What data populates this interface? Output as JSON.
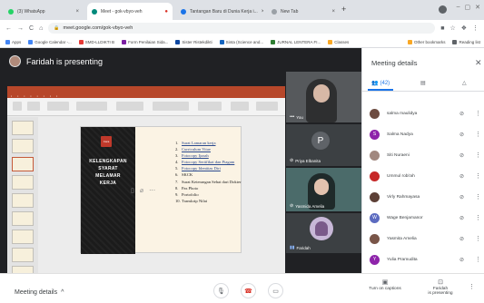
{
  "browser": {
    "tabs": [
      {
        "label": "(3) WhatsApp",
        "color": "#25d366",
        "active": false
      },
      {
        "label": "Meet - gok-vbyo-veh",
        "color": "#00897b",
        "active": true
      },
      {
        "label": "Tantangan Baru di Dunia Kerja i...",
        "color": "#1a73e8",
        "active": false
      },
      {
        "label": "New Tab",
        "color": "#9aa0a6",
        "active": false
      }
    ],
    "url": "meet.google.com/gok-vbyo-veh",
    "bookmarks": [
      {
        "label": "Apps",
        "color": "#4285f4"
      },
      {
        "label": "Google Calendar -...",
        "color": "#4285f4"
      },
      {
        "label": "SMD-LLDIKTI B",
        "color": "#e53935"
      },
      {
        "label": "Form Penilaian Sida...",
        "color": "#7b1fa2"
      },
      {
        "label": "Sister Ristekdikti",
        "color": "#0d47a1"
      },
      {
        "label": "Sinta (Science and...",
        "color": "#1565c0"
      },
      {
        "label": "JURNAL LENTERA FI...",
        "color": "#2e7d32"
      },
      {
        "label": "Classes",
        "color": "#f9a825"
      }
    ],
    "bookmarks_right": [
      {
        "label": "Other bookmarks",
        "color": "#f9a825"
      },
      {
        "label": "Reading list",
        "color": "#5f6368"
      }
    ]
  },
  "meeting": {
    "presenting_label": "Faridah is presenting",
    "code": "gok-vbyo-veh",
    "slide": {
      "tag": "Cara",
      "heading": [
        "KELENGKAPAN",
        "SYARAT",
        "MELAMAR",
        "KERJA"
      ],
      "items": [
        {
          "n": "1.",
          "text": "Surat Lamaran kerja",
          "link": true
        },
        {
          "n": "2.",
          "text": "Curriculum Vitae",
          "link": true
        },
        {
          "n": "3.",
          "text": "Fotocopy Ijazah",
          "link": true
        },
        {
          "n": "4.",
          "text": "Fotocopy Sertifikat dan Piagam",
          "link": true
        },
        {
          "n": "5.",
          "text": "Fotocopy Identitas Diri",
          "link": true
        },
        {
          "n": "6.",
          "text": "SKCK",
          "link": false
        },
        {
          "n": "7.",
          "text": "Surat Keterangan Sehat dari Dokter",
          "link": false
        },
        {
          "n": "8.",
          "text": "Pas Photo",
          "link": false
        },
        {
          "n": "9.",
          "text": "Portofolio",
          "link": false
        },
        {
          "n": "10.",
          "text": "Transkrip Nilai",
          "link": false
        }
      ]
    },
    "tiles": [
      {
        "name": "You",
        "type": "video",
        "bg": "#5f6368"
      },
      {
        "name": "Priya Elbanita",
        "type": "initial",
        "initial": "P",
        "bg": "#3c4043",
        "avatar": "#5f6368"
      },
      {
        "name": "Yasmida Amelia",
        "type": "video",
        "bg": "#4b6b6a"
      },
      {
        "name": "Faridah",
        "type": "avatar",
        "bg": "#3c4043"
      }
    ]
  },
  "controls": {
    "meeting_details": "Meeting details",
    "captions": "Turn on captions",
    "presenting": "Faridah\nis presenting"
  },
  "side_panel": {
    "title": "Meeting details",
    "people_count": "(42)",
    "participants": [
      {
        "name": "salma maulidya",
        "initial": "",
        "color": "#6d4c41"
      },
      {
        "name": "Salma Nadya",
        "initial": "S",
        "color": "#8e24aa"
      },
      {
        "name": "Siti Nuraeni",
        "initial": "",
        "color": "#a1887f"
      },
      {
        "name": "Ummul robi'ah",
        "initial": "",
        "color": "#c62828"
      },
      {
        "name": "Virly Rahmayasa",
        "initial": "",
        "color": "#5d4037"
      },
      {
        "name": "Wage Benjamanor",
        "initial": "W",
        "color": "#5c6bc0"
      },
      {
        "name": "Yasmita Amelia",
        "initial": "",
        "color": "#795548"
      },
      {
        "name": "Yulia Pramudita",
        "initial": "Y",
        "color": "#8e24aa"
      }
    ]
  }
}
